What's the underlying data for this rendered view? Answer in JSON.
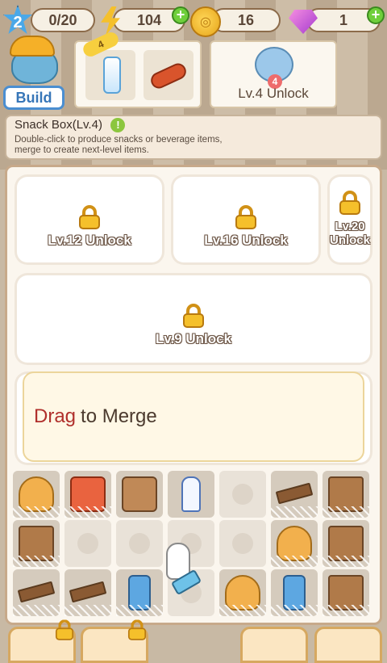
{
  "stats": {
    "level": "2",
    "progress": "0/20",
    "energy": "104",
    "coins": "16",
    "gems": "1"
  },
  "header": {
    "build_label": "Build",
    "reward_badge": "4",
    "unlock_badge": "4",
    "unlock_label": "Lv.4 Unlock"
  },
  "info": {
    "title": "Snack Box(Lv.4)",
    "info_glyph": "!",
    "description": "Double-click to produce snacks or beverage items, merge to create next-level items."
  },
  "locked_areas": [
    {
      "label": "Lv.12 Unlock"
    },
    {
      "label": "Lv.16 Unlock"
    },
    {
      "label": "Lv.20 Unlock"
    },
    {
      "label": "Lv.9 Unlock"
    }
  ],
  "tooltip": {
    "highlight": "Drag",
    "rest": "to Merge"
  },
  "grid": {
    "rows": [
      [
        "cup",
        "chips",
        "crate",
        "milk",
        "empty",
        "plank",
        "box"
      ],
      [
        "box",
        "empty",
        "empty",
        "empty",
        "empty",
        "cup",
        "box"
      ],
      [
        "plank",
        "plank",
        "can",
        "empty",
        "cup",
        "can",
        "box"
      ]
    ]
  },
  "colors": {
    "accent_blue": "#4aa8e8",
    "tooltip_drag": "#b0302c",
    "gold": "#f5c02b"
  }
}
